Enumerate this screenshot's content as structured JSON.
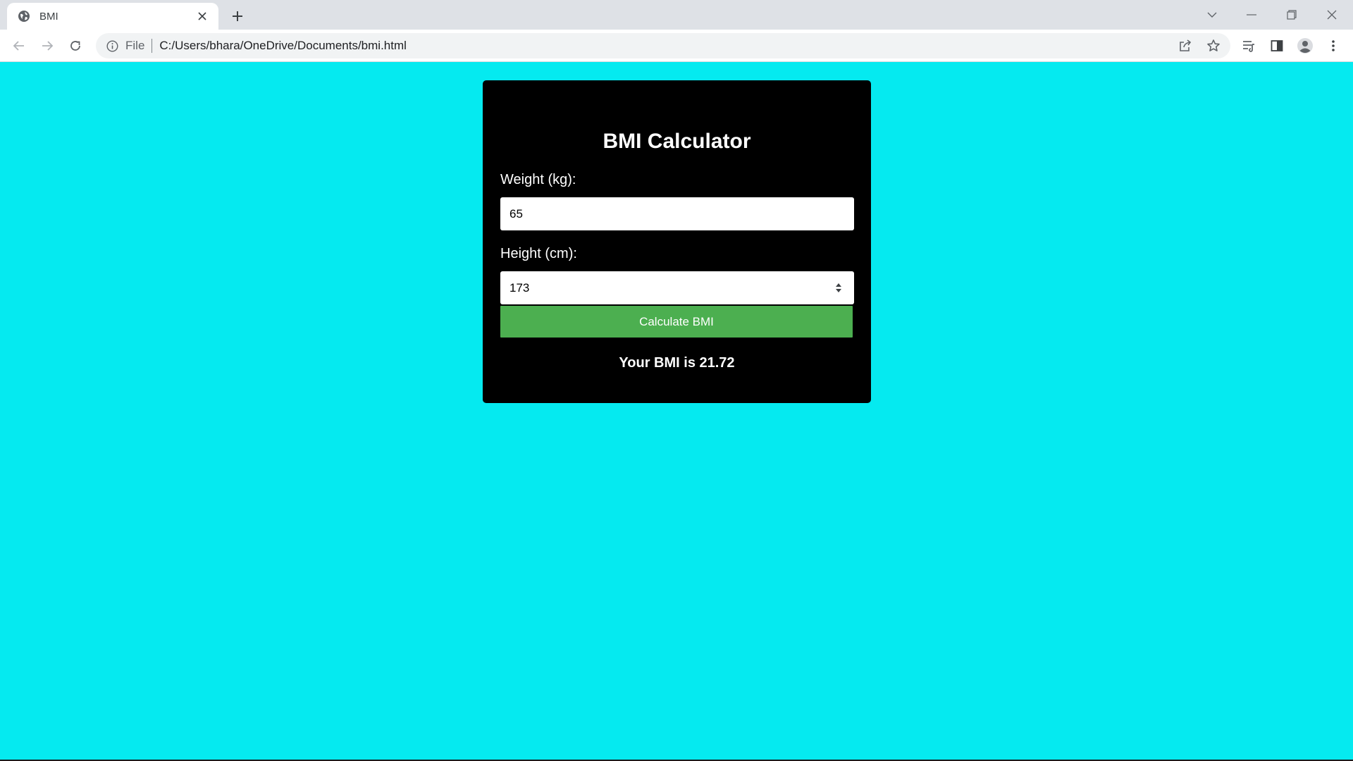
{
  "browser": {
    "tab_title": "BMI",
    "address_scheme": "File",
    "address_url": "C:/Users/bhara/OneDrive/Documents/bmi.html"
  },
  "page": {
    "title": "BMI Calculator",
    "weight_label": "Weight (kg):",
    "weight_value": "65",
    "height_label": "Height (cm):",
    "height_value": "173",
    "button_label": "Calculate BMI",
    "result_text": "Your BMI is 21.72"
  },
  "colors": {
    "page_background": "#05eaf0",
    "card_background": "#000000",
    "button_background": "#4caf50"
  },
  "icons": [
    "globe-icon",
    "close-icon",
    "plus-icon",
    "back-icon",
    "forward-icon",
    "reload-icon",
    "info-icon",
    "share-icon",
    "star-icon",
    "reading-list-icon",
    "side-panel-icon",
    "profile-icon",
    "more-icon"
  ]
}
